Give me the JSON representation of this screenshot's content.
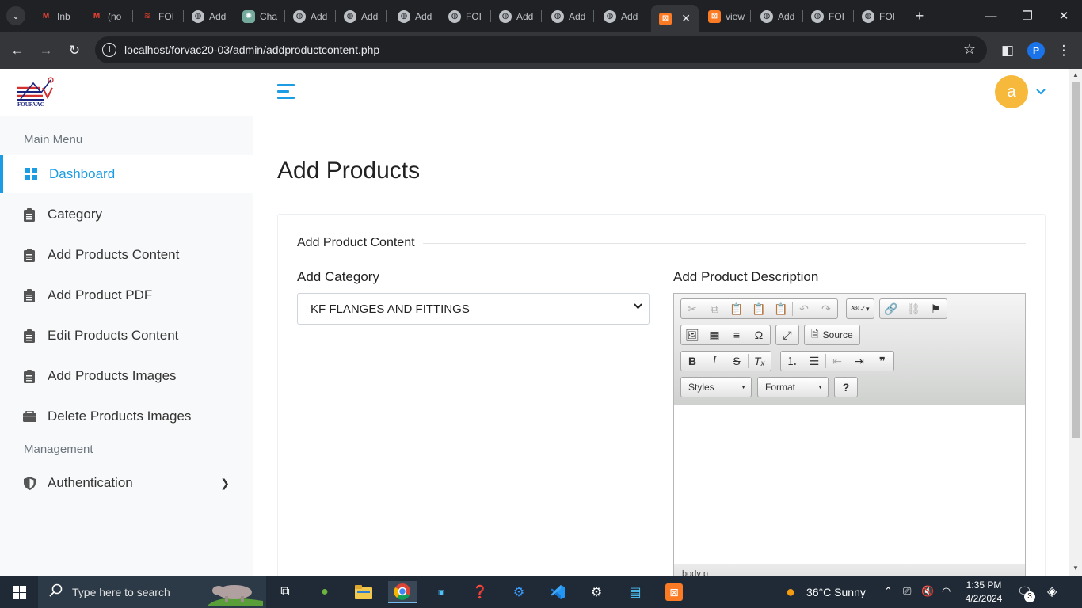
{
  "browser": {
    "tabs": [
      {
        "label": "Inb",
        "icon": "gmail-icon"
      },
      {
        "label": "(no",
        "icon": "gmail-icon"
      },
      {
        "label": "FOI",
        "icon": "site-logo-icon"
      },
      {
        "label": "Add",
        "icon": "globe-icon"
      },
      {
        "label": "Cha",
        "icon": "chatgpt-icon"
      },
      {
        "label": "Add",
        "icon": "globe-icon"
      },
      {
        "label": "Add",
        "icon": "globe-icon"
      },
      {
        "label": "Add",
        "icon": "globe-icon"
      },
      {
        "label": "FOI",
        "icon": "globe-icon"
      },
      {
        "label": "Add",
        "icon": "globe-icon"
      },
      {
        "label": "Add",
        "icon": "globe-icon"
      },
      {
        "label": "Add",
        "icon": "globe-icon"
      },
      {
        "label": "",
        "icon": "xampp-icon",
        "active": true
      },
      {
        "label": "view",
        "icon": "xampp-icon"
      },
      {
        "label": "Add",
        "icon": "globe-icon"
      },
      {
        "label": "FOI",
        "icon": "globe-icon"
      },
      {
        "label": "FOI",
        "icon": "globe-icon"
      }
    ],
    "url": "localhost/forvac20-03/admin/addproductcontent.php",
    "profile_initial": "P"
  },
  "sidebar": {
    "logo_text": "FOURVAC",
    "main_menu_title": "Main Menu",
    "management_title": "Management",
    "items": [
      {
        "label": "Dashboard",
        "icon": "dashboard-grid-icon",
        "active": true
      },
      {
        "label": "Category",
        "icon": "clipboard-icon"
      },
      {
        "label": "Add Products Content",
        "icon": "clipboard-icon"
      },
      {
        "label": "Add Product PDF",
        "icon": "clipboard-icon"
      },
      {
        "label": "Edit Products Content",
        "icon": "clipboard-icon"
      },
      {
        "label": "Add Products Images",
        "icon": "clipboard-icon"
      },
      {
        "label": "Delete Products Images",
        "icon": "folder-icon"
      }
    ],
    "auth_item": {
      "label": "Authentication",
      "icon": "shield-icon"
    }
  },
  "header": {
    "avatar_initial": "a"
  },
  "main": {
    "page_title": "Add Products",
    "section_legend": "Add Product Content",
    "category_label": "Add Category",
    "category_selected": "KF FLANGES AND FITTINGS",
    "description_label": "Add Product Description",
    "editor": {
      "source_label": "Source",
      "styles_label": "Styles",
      "format_label": "Format",
      "help_label": "?",
      "path": "body   p"
    }
  },
  "taskbar": {
    "search_placeholder": "Type here to search",
    "weather": "36°C  Sunny",
    "time": "1:35 PM",
    "date": "4/2/2024",
    "notification_count": "3"
  },
  "colors": {
    "accent": "#1b9ce3",
    "avatar": "#f6b93b",
    "browser_bg": "#202124"
  }
}
